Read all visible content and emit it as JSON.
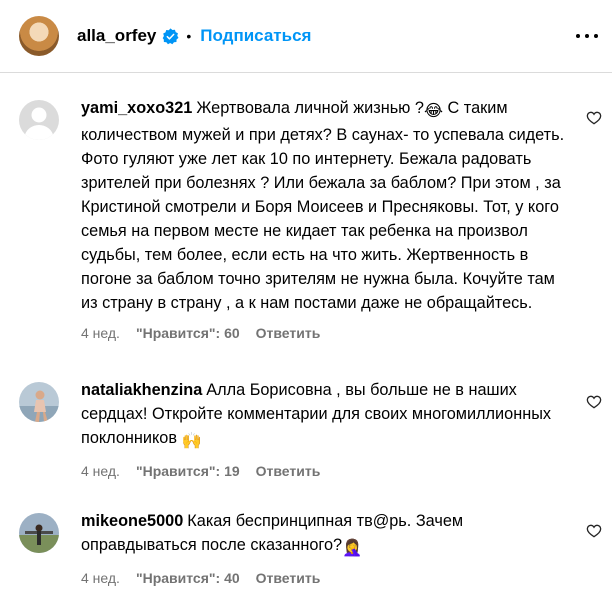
{
  "post": {
    "username": "alla_orfey",
    "follow_label": "Подписаться",
    "dot": "•",
    "verified_icon": "verified-badge-icon",
    "accent": "#0095f6"
  },
  "comments": [
    {
      "username": "yami_xoxo321",
      "text_1": "Жертвовала личной жизнью ?",
      "emoji_1": "😂",
      "text_2": " С таким количеством мужей и при детях? В саунах- то успевала сидеть. Фото гуляют уже лет как 10 по интернету. Бежала радовать зрителей при болезнях ? Или бежала за баблом? При этом , за Кристиной смотрели и Боря Моисеев и Пресняковы. Тот, у кого семья на первом месте не кидает так ребенка на произвол судьбы, тем более, если есть на что жить. Жертвенность в погоне за баблом точно зрителям не нужна была. Кочуйте там из страну в страну , а к нам постами даже не обращайтесь.",
      "time": "4 нед.",
      "likes": "\"Нравится\": 60",
      "reply": "Ответить"
    },
    {
      "username": "nataliakhenzina",
      "text_1": "Алла Борисовна , вы больше не в наших сердцах! Откройте комментарии для своих многомиллионных поклонников ",
      "emoji_1": "🙌",
      "text_2": "",
      "time": "4 нед.",
      "likes": "\"Нравится\": 19",
      "reply": "Ответить"
    },
    {
      "username": "mikeone5000",
      "text_1": "Какая беспринципная тв@рь. Зачем оправдываться после сказанного?",
      "emoji_1": "🤦‍♀️",
      "text_2": "",
      "time": "4 нед.",
      "likes": "\"Нравится\": 40",
      "reply": "Ответить"
    }
  ]
}
